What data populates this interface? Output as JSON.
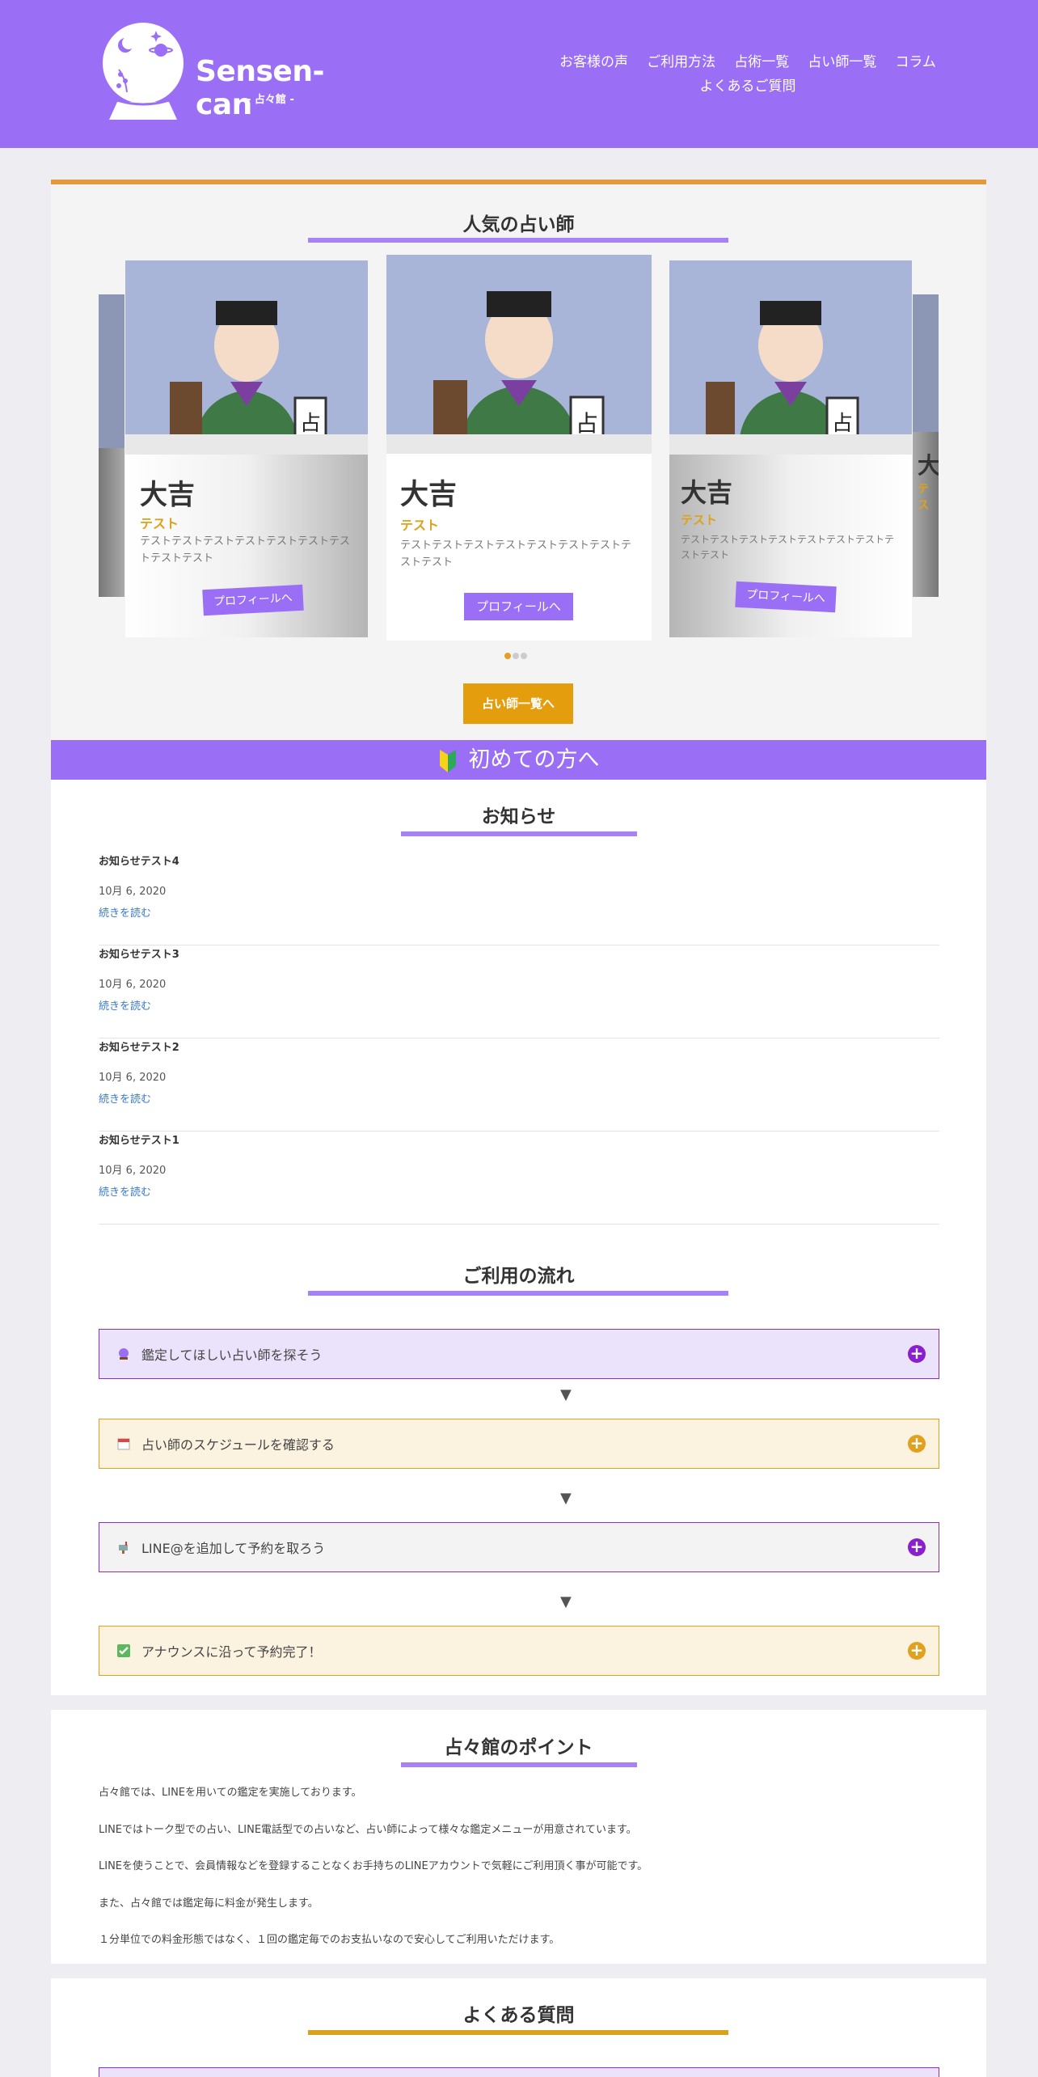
{
  "header": {
    "logo_name": "Sensen-can",
    "logo_sub": "- 占々館 -",
    "nav": [
      "お客様の声",
      "ご利用方法",
      "占術一覧",
      "占い師一覧",
      "コラム",
      "よくあるご質問"
    ]
  },
  "popular": {
    "title": "人気の占い師",
    "cards": [
      {
        "name": "大吉",
        "tag": "テスト",
        "desc": "テストテストテストテストテストテストテストテストテスト",
        "button": "プロフィールへ"
      },
      {
        "name": "大吉",
        "tag": "テスト",
        "desc": "テストテストテストテストテストテストテストテストテスト",
        "button": "プロフィールへ"
      },
      {
        "name": "大吉",
        "tag": "テスト",
        "desc": "テストテストテストテストテストテストテストテストテスト",
        "button": "プロフィールへ"
      },
      {
        "name": "大",
        "tag": "テス",
        "desc": "テストテ",
        "button": ""
      }
    ],
    "list_button": "占い師一覧へ"
  },
  "beginner": {
    "label": "初めての方へ"
  },
  "news": {
    "title": "お知らせ",
    "items": [
      {
        "title": "お知らせテスト4",
        "date": "10月 6, 2020",
        "more": "続きを読む"
      },
      {
        "title": "お知らせテスト3",
        "date": "10月 6, 2020",
        "more": "続きを読む"
      },
      {
        "title": "お知らせテスト2",
        "date": "10月 6, 2020",
        "more": "続きを読む"
      },
      {
        "title": "お知らせテスト1",
        "date": "10月 6, 2020",
        "more": "続きを読む"
      }
    ]
  },
  "flow": {
    "title": "ご利用の流れ",
    "steps": [
      {
        "label": "鑑定してほしい占い師を探そう",
        "icon": "crystal-ball-icon"
      },
      {
        "label": "占い師のスケジュールを確認する",
        "icon": "calendar-icon"
      },
      {
        "label": "LINE@を追加して予約を取ろう",
        "icon": "mailbox-icon"
      },
      {
        "label": "アナウンスに沿って予約完了！",
        "icon": "check-icon"
      }
    ],
    "arrow": "▼"
  },
  "points": {
    "title": "占々館のポイント",
    "paragraphs": [
      "占々館では、LINEを用いての鑑定を実施しております。",
      "LINEではトーク型での占い、LINE電話型での占いなど、占い師によって様々な鑑定メニューが用意されています。",
      "LINEを使うことで、会員情報などを登録することなくお手持ちのLINEアカウントで気軽にご利用頂く事が可能です。",
      "また、占々館では鑑定毎に料金が発生します。",
      "１分単位での料金形態ではなく、１回の鑑定毎でのお支払いなので安心してご利用いただけます。"
    ]
  },
  "faq": {
    "title": "よくある質問"
  },
  "colors": {
    "brand": "#9a6ff6",
    "accent": "#e49d0d",
    "link": "#3a7bc8"
  }
}
